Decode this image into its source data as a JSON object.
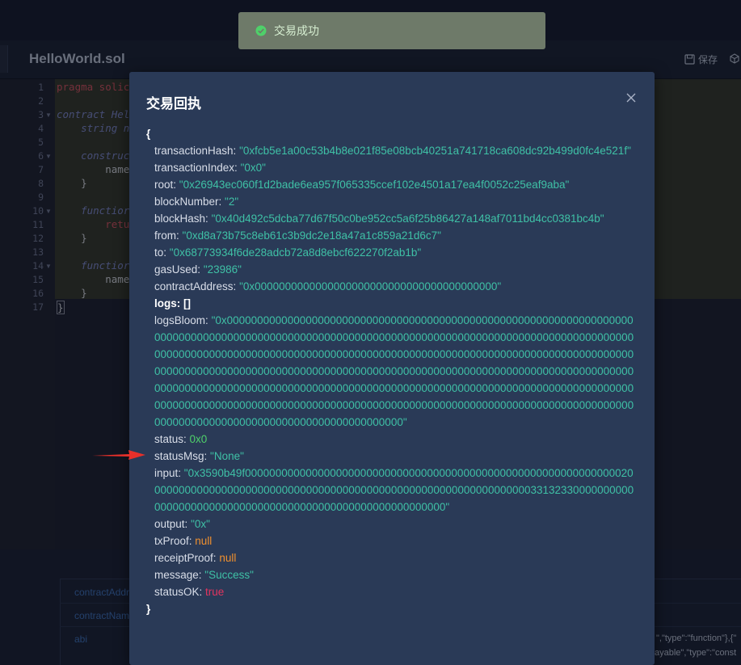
{
  "file_header": {
    "title": "HelloWorld.sol",
    "save_label": "保存"
  },
  "editor": {
    "line_numbers": [
      "1",
      "2",
      "3",
      "4",
      "5",
      "6",
      "7",
      "8",
      "9",
      "10",
      "11",
      "12",
      "13",
      "14",
      "15",
      "16",
      "17"
    ],
    "lines": [
      "pragma solic",
      "",
      "contract Hel",
      "    string n",
      "",
      "    construc",
      "        name",
      "    }",
      "",
      "    functior",
      "        retu",
      "    }",
      "",
      "    functior",
      "        name",
      "    }",
      "}"
    ]
  },
  "bottom_panel": {
    "labels": [
      "contractAddr",
      "contractNam",
      "abi"
    ],
    "abi_lines": [
      "\",\"type\":\"function\"},{\"",
      "ayable\",\"type\":\"const"
    ]
  },
  "toast": {
    "message": "交易成功",
    "icon": "check-circle-icon"
  },
  "modal": {
    "title": "交易回执",
    "open_brace": "{",
    "close_brace": "}",
    "fields": {
      "transactionHash": {
        "key": "transactionHash:",
        "value": "\"0xfcb5e1a00c53b4b8e021f85e08bcb40251a741718ca608dc92b499d0fc4e521f\""
      },
      "transactionIndex": {
        "key": "transactionIndex:",
        "value": "\"0x0\""
      },
      "root": {
        "key": "root:",
        "value": "\"0x26943ec060f1d2bade6ea957f065335ccef102e4501a17ea4f0052c25eaf9aba\""
      },
      "blockNumber": {
        "key": "blockNumber:",
        "value": "\"2\""
      },
      "blockHash": {
        "key": "blockHash:",
        "value": "\"0x40d492c5dcba77d67f50c0be952cc5a6f25b86427a148af7011bd4cc0381bc4b\""
      },
      "from": {
        "key": "from:",
        "value": "\"0xd8a73b75c8eb61c3b9dc2e18a47a1c859a21d6c7\""
      },
      "to": {
        "key": "to:",
        "value": "\"0x68773934f6de28adcb72a8d8ebcf622270f2ab1b\""
      },
      "gasUsed": {
        "key": "gasUsed:",
        "value": "\"23986\""
      },
      "contractAddress": {
        "key": "contractAddress:",
        "value": "\"0x0000000000000000000000000000000000000000\""
      },
      "logs": {
        "key": "logs: []"
      },
      "logsBloom": {
        "key": "logsBloom:",
        "value": "\"0x00000000000000000000000000000000000000000000000000000000000000000000000000000000000000000000000000000000000000000000000000000000000000000000000000000000000000000000000000000000000000000000000000000000000000000000000000000000000000000000000000000000000000000000000000000000000000000000000000000000000000000000000000000000000000000000000000000000000000000000000000000000000000000000000000000000000000000000000000000000000000000000000000000000000000000000000000000000000000000000000000000000000000000000000\""
      },
      "status": {
        "key": "status:",
        "value": "0x0"
      },
      "statusMsg": {
        "key": "statusMsg:",
        "value": "\"None\""
      },
      "input": {
        "key": "input:",
        "value": "\"0x3590b49f00000000000000000000000000000000000000000000000000000000000000200000000000000000000000000000000000000000000000000000000000000033132330000000000000000000000000000000000000000000000000000000000\""
      },
      "output": {
        "key": "output:",
        "value": "\"0x\""
      },
      "txProof": {
        "key": "txProof:",
        "value": "null"
      },
      "receiptProof": {
        "key": "receiptProof:",
        "value": "null"
      },
      "message": {
        "key": "message:",
        "value": "\"Success\""
      },
      "statusOK": {
        "key": "statusOK:",
        "value": "true"
      }
    }
  },
  "colors": {
    "string_value": "#3fc1a6",
    "number_value": "#4fd06a",
    "null_value": "#f0902e",
    "boolean_value": "#e3345f",
    "annotation_arrow": "#e8302a"
  }
}
